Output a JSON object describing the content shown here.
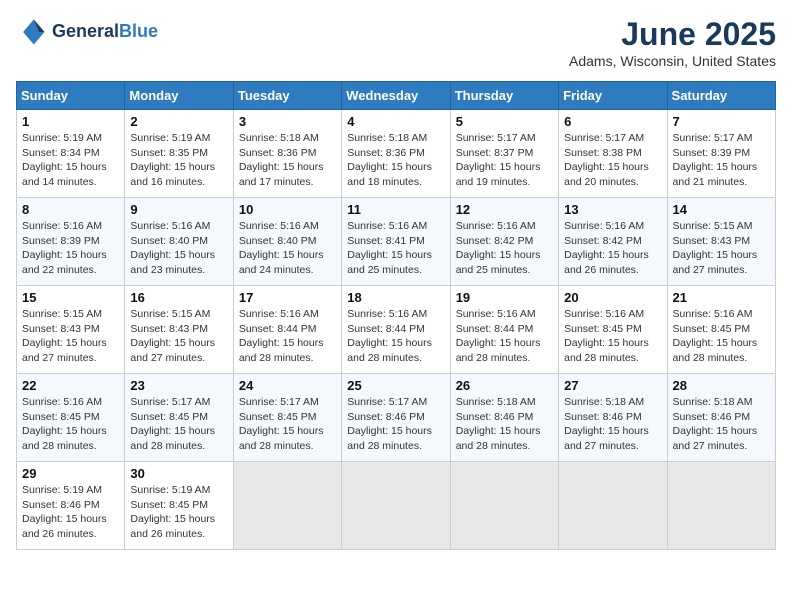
{
  "header": {
    "logo_line1": "General",
    "logo_line2": "Blue",
    "month": "June 2025",
    "location": "Adams, Wisconsin, United States"
  },
  "days_of_week": [
    "Sunday",
    "Monday",
    "Tuesday",
    "Wednesday",
    "Thursday",
    "Friday",
    "Saturday"
  ],
  "weeks": [
    [
      {
        "day": "1",
        "lines": [
          "Sunrise: 5:19 AM",
          "Sunset: 8:34 PM",
          "Daylight: 15 hours",
          "and 14 minutes."
        ]
      },
      {
        "day": "2",
        "lines": [
          "Sunrise: 5:19 AM",
          "Sunset: 8:35 PM",
          "Daylight: 15 hours",
          "and 16 minutes."
        ]
      },
      {
        "day": "3",
        "lines": [
          "Sunrise: 5:18 AM",
          "Sunset: 8:36 PM",
          "Daylight: 15 hours",
          "and 17 minutes."
        ]
      },
      {
        "day": "4",
        "lines": [
          "Sunrise: 5:18 AM",
          "Sunset: 8:36 PM",
          "Daylight: 15 hours",
          "and 18 minutes."
        ]
      },
      {
        "day": "5",
        "lines": [
          "Sunrise: 5:17 AM",
          "Sunset: 8:37 PM",
          "Daylight: 15 hours",
          "and 19 minutes."
        ]
      },
      {
        "day": "6",
        "lines": [
          "Sunrise: 5:17 AM",
          "Sunset: 8:38 PM",
          "Daylight: 15 hours",
          "and 20 minutes."
        ]
      },
      {
        "day": "7",
        "lines": [
          "Sunrise: 5:17 AM",
          "Sunset: 8:39 PM",
          "Daylight: 15 hours",
          "and 21 minutes."
        ]
      }
    ],
    [
      {
        "day": "8",
        "lines": [
          "Sunrise: 5:16 AM",
          "Sunset: 8:39 PM",
          "Daylight: 15 hours",
          "and 22 minutes."
        ]
      },
      {
        "day": "9",
        "lines": [
          "Sunrise: 5:16 AM",
          "Sunset: 8:40 PM",
          "Daylight: 15 hours",
          "and 23 minutes."
        ]
      },
      {
        "day": "10",
        "lines": [
          "Sunrise: 5:16 AM",
          "Sunset: 8:40 PM",
          "Daylight: 15 hours",
          "and 24 minutes."
        ]
      },
      {
        "day": "11",
        "lines": [
          "Sunrise: 5:16 AM",
          "Sunset: 8:41 PM",
          "Daylight: 15 hours",
          "and 25 minutes."
        ]
      },
      {
        "day": "12",
        "lines": [
          "Sunrise: 5:16 AM",
          "Sunset: 8:42 PM",
          "Daylight: 15 hours",
          "and 25 minutes."
        ]
      },
      {
        "day": "13",
        "lines": [
          "Sunrise: 5:16 AM",
          "Sunset: 8:42 PM",
          "Daylight: 15 hours",
          "and 26 minutes."
        ]
      },
      {
        "day": "14",
        "lines": [
          "Sunrise: 5:15 AM",
          "Sunset: 8:43 PM",
          "Daylight: 15 hours",
          "and 27 minutes."
        ]
      }
    ],
    [
      {
        "day": "15",
        "lines": [
          "Sunrise: 5:15 AM",
          "Sunset: 8:43 PM",
          "Daylight: 15 hours",
          "and 27 minutes."
        ]
      },
      {
        "day": "16",
        "lines": [
          "Sunrise: 5:15 AM",
          "Sunset: 8:43 PM",
          "Daylight: 15 hours",
          "and 27 minutes."
        ]
      },
      {
        "day": "17",
        "lines": [
          "Sunrise: 5:16 AM",
          "Sunset: 8:44 PM",
          "Daylight: 15 hours",
          "and 28 minutes."
        ]
      },
      {
        "day": "18",
        "lines": [
          "Sunrise: 5:16 AM",
          "Sunset: 8:44 PM",
          "Daylight: 15 hours",
          "and 28 minutes."
        ]
      },
      {
        "day": "19",
        "lines": [
          "Sunrise: 5:16 AM",
          "Sunset: 8:44 PM",
          "Daylight: 15 hours",
          "and 28 minutes."
        ]
      },
      {
        "day": "20",
        "lines": [
          "Sunrise: 5:16 AM",
          "Sunset: 8:45 PM",
          "Daylight: 15 hours",
          "and 28 minutes."
        ]
      },
      {
        "day": "21",
        "lines": [
          "Sunrise: 5:16 AM",
          "Sunset: 8:45 PM",
          "Daylight: 15 hours",
          "and 28 minutes."
        ]
      }
    ],
    [
      {
        "day": "22",
        "lines": [
          "Sunrise: 5:16 AM",
          "Sunset: 8:45 PM",
          "Daylight: 15 hours",
          "and 28 minutes."
        ]
      },
      {
        "day": "23",
        "lines": [
          "Sunrise: 5:17 AM",
          "Sunset: 8:45 PM",
          "Daylight: 15 hours",
          "and 28 minutes."
        ]
      },
      {
        "day": "24",
        "lines": [
          "Sunrise: 5:17 AM",
          "Sunset: 8:45 PM",
          "Daylight: 15 hours",
          "and 28 minutes."
        ]
      },
      {
        "day": "25",
        "lines": [
          "Sunrise: 5:17 AM",
          "Sunset: 8:46 PM",
          "Daylight: 15 hours",
          "and 28 minutes."
        ]
      },
      {
        "day": "26",
        "lines": [
          "Sunrise: 5:18 AM",
          "Sunset: 8:46 PM",
          "Daylight: 15 hours",
          "and 28 minutes."
        ]
      },
      {
        "day": "27",
        "lines": [
          "Sunrise: 5:18 AM",
          "Sunset: 8:46 PM",
          "Daylight: 15 hours",
          "and 27 minutes."
        ]
      },
      {
        "day": "28",
        "lines": [
          "Sunrise: 5:18 AM",
          "Sunset: 8:46 PM",
          "Daylight: 15 hours",
          "and 27 minutes."
        ]
      }
    ],
    [
      {
        "day": "29",
        "lines": [
          "Sunrise: 5:19 AM",
          "Sunset: 8:46 PM",
          "Daylight: 15 hours",
          "and 26 minutes."
        ]
      },
      {
        "day": "30",
        "lines": [
          "Sunrise: 5:19 AM",
          "Sunset: 8:45 PM",
          "Daylight: 15 hours",
          "and 26 minutes."
        ]
      },
      null,
      null,
      null,
      null,
      null
    ]
  ]
}
